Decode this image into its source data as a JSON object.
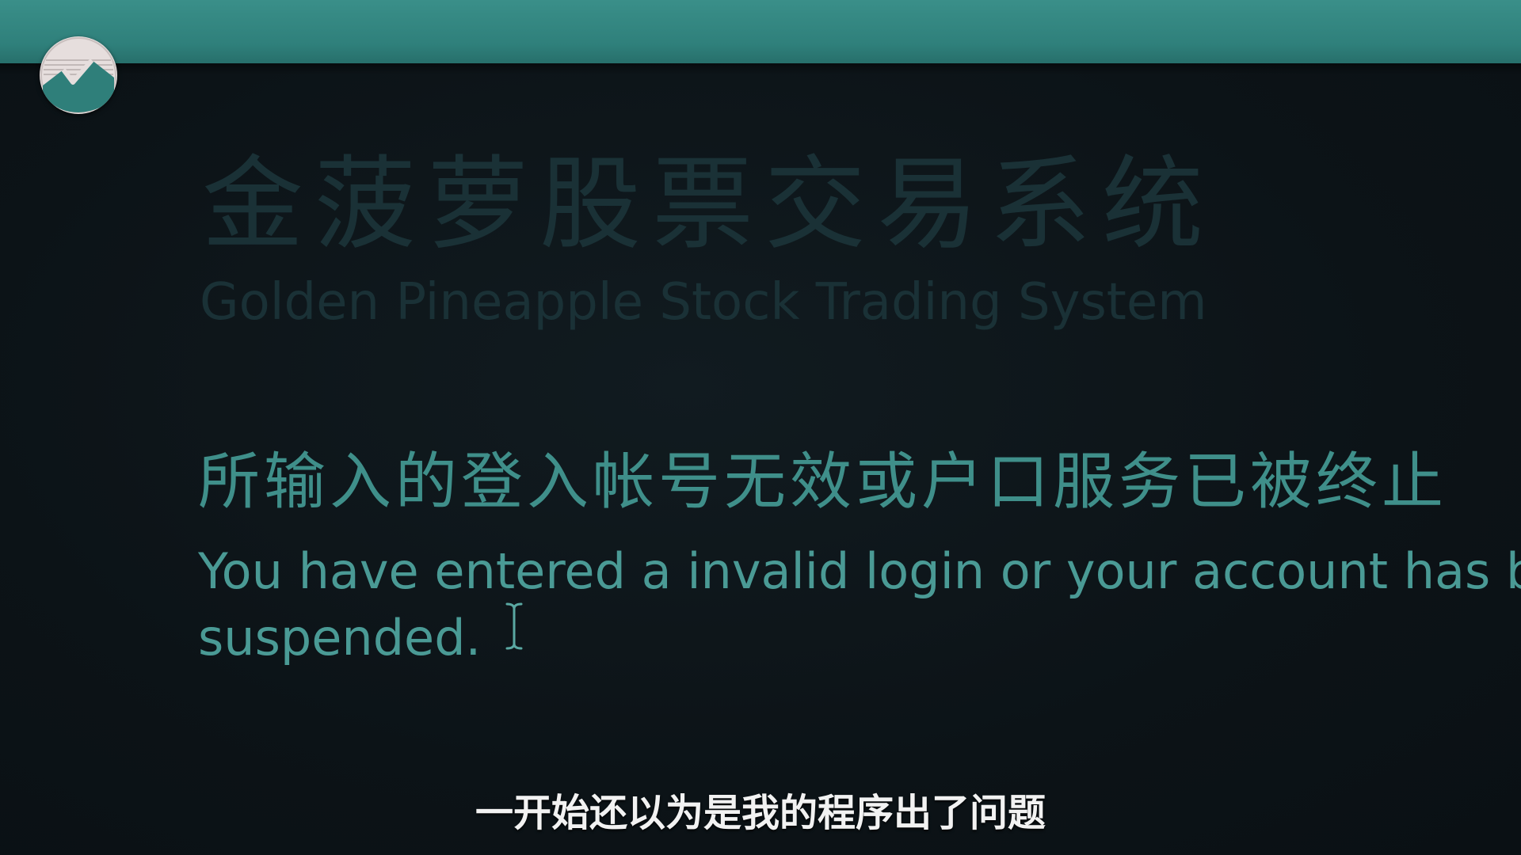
{
  "header": {
    "logo_icon": "channel-logo-icon",
    "bar_color": "#2f807b"
  },
  "system": {
    "title_cn": "金菠萝股票交易系统",
    "title_en": "Golden Pineapple Stock Trading System"
  },
  "error": {
    "message_cn": "所输入的登入帐号无效或户口服务已被终止",
    "message_en_line1": "You have entered a invalid login or your account has been",
    "message_en_line2": "suspended.",
    "cursor_icon": "text-cursor-icon",
    "accent_color": "#4a9a95"
  },
  "caption": {
    "text": "一开始还以为是我的程序出了问题"
  }
}
